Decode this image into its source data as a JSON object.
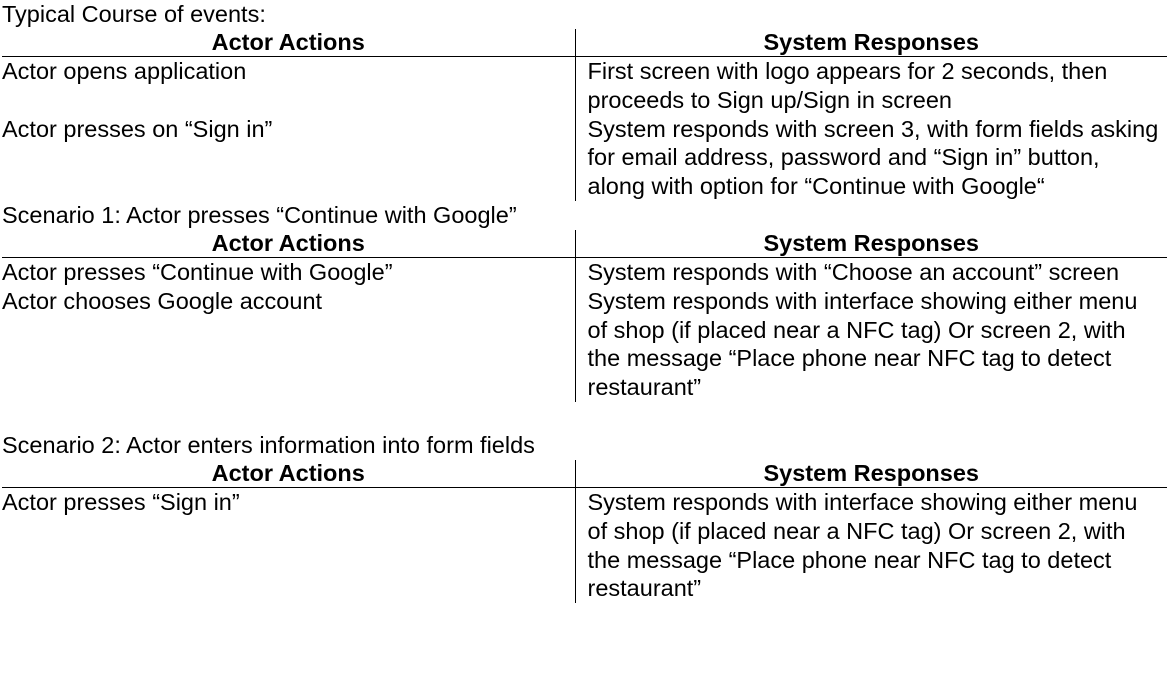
{
  "typical": {
    "title": "Typical Course of events:",
    "header_actor": "Actor Actions",
    "header_system": "System Responses",
    "rows": [
      {
        "actor": "Actor opens application",
        "system": "First screen with logo appears for 2 seconds, then proceeds to Sign up/Sign in screen"
      },
      {
        "actor": "Actor presses on “Sign in”",
        "system": "System responds with screen 3, with form fields asking for email address, password and “Sign in” button, along with option for “Continue with Google“"
      }
    ]
  },
  "scenario1": {
    "title": "Scenario 1: Actor presses “Continue with Google”",
    "header_actor": "Actor Actions",
    "header_system": "System Responses",
    "rows": [
      {
        "actor": "Actor presses “Continue with Google”",
        "system": "System responds with “Choose an account” screen"
      },
      {
        "actor": "Actor chooses Google account",
        "system": "System responds with interface showing either menu of shop (if placed near a NFC tag) Or screen 2, with the message “Place phone near NFC tag to detect restaurant”"
      }
    ]
  },
  "scenario2": {
    "title": "Scenario 2: Actor enters information into form fields",
    "header_actor": "Actor Actions",
    "header_system": "System Responses",
    "rows": [
      {
        "actor": "Actor presses “Sign in”",
        "system": "System responds with interface showing either menu of shop (if placed near a NFC tag) Or screen 2, with the message “Place phone near NFC tag to detect restaurant”"
      }
    ]
  }
}
